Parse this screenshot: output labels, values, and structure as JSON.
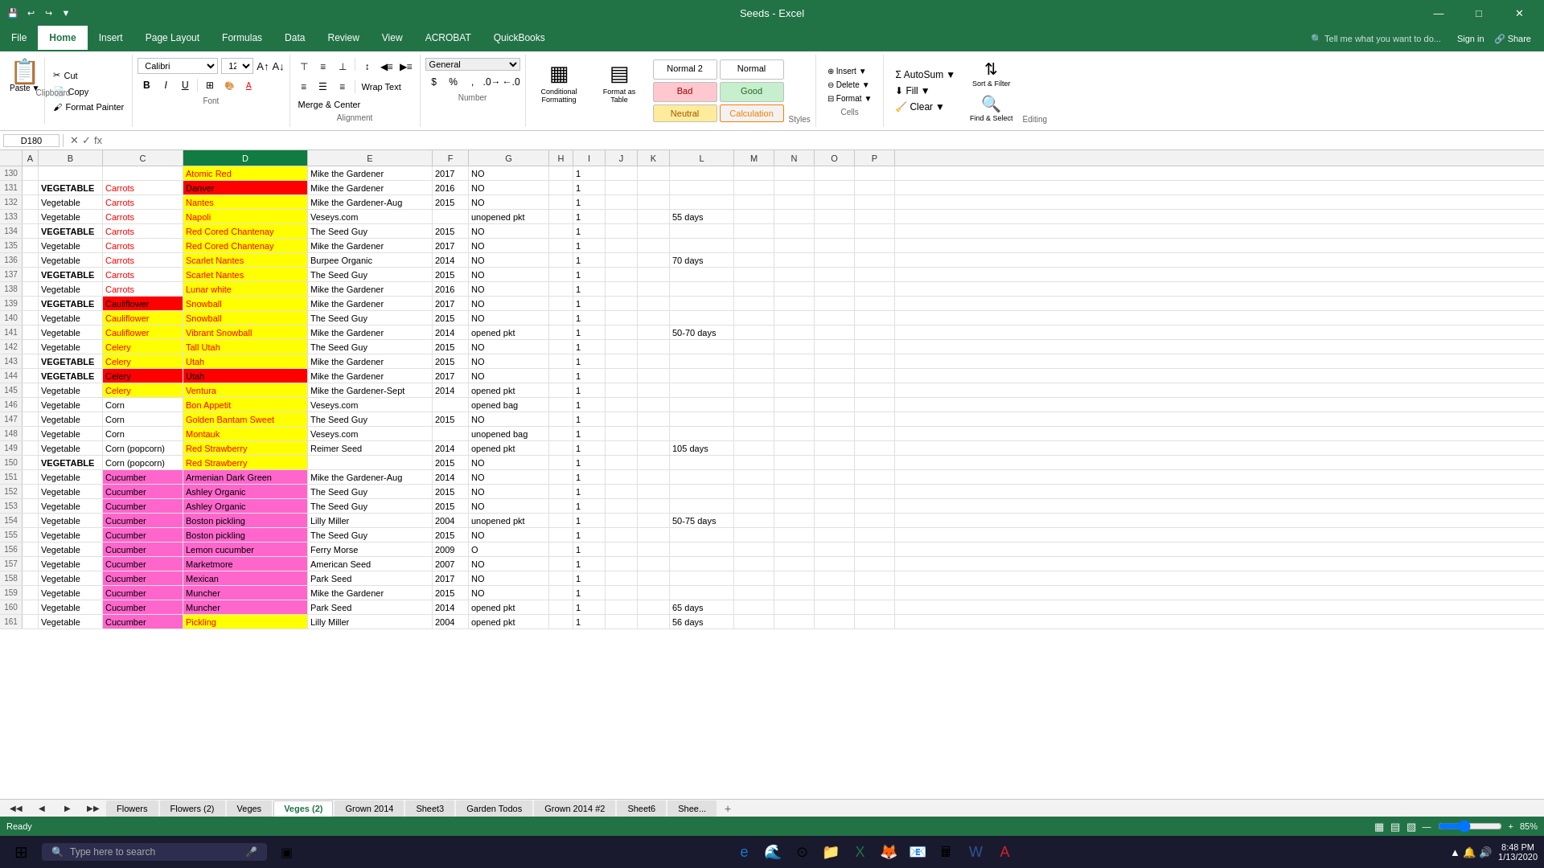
{
  "titlebar": {
    "title": "Seeds - Excel",
    "minimize": "—",
    "maximize": "□",
    "close": "✕"
  },
  "ribbon": {
    "tabs": [
      "File",
      "Home",
      "Insert",
      "Page Layout",
      "Formulas",
      "Data",
      "Review",
      "View",
      "ACROBAT",
      "QuickBooks"
    ],
    "active_tab": "Home",
    "search_placeholder": "Tell me what you want to do...",
    "groups": {
      "clipboard": {
        "label": "Clipboard",
        "paste": "Paste",
        "cut": "Cut",
        "copy": "Copy",
        "format_painter": "Format Painter"
      },
      "font": {
        "label": "Font",
        "name": "Calibri",
        "size": "12"
      },
      "alignment": {
        "label": "Alignment",
        "wrap_text": "Wrap Text",
        "merge_center": "Merge & Center"
      },
      "number": {
        "label": "Number",
        "format": "General"
      },
      "styles": {
        "label": "Styles",
        "normal2_label": "Normal 2",
        "normal_label": "Normal",
        "bad_label": "Bad",
        "good_label": "Good",
        "neutral_label": "Neutral",
        "calculation_label": "Calculation",
        "cond_format": "Conditional Formatting",
        "format_table": "Format as Table"
      },
      "cells": {
        "label": "Cells",
        "insert": "Insert",
        "delete": "Delete",
        "format": "Format"
      },
      "editing": {
        "label": "Editing",
        "autosum": "AutoSum",
        "fill": "Fill",
        "clear": "Clear",
        "sort_filter": "Sort & Filter",
        "find_select": "Find & Select"
      }
    }
  },
  "formula_bar": {
    "cell_ref": "D180",
    "formula": ""
  },
  "columns": [
    "",
    "A",
    "B",
    "C",
    "D",
    "E",
    "F",
    "G",
    "H",
    "I",
    "J",
    "K",
    "L",
    "M",
    "N",
    "O",
    "P"
  ],
  "rows": [
    {
      "num": "130",
      "a": "",
      "b": "",
      "c": "",
      "d": "Atomic Red",
      "e": "Mike the Gardener",
      "f": "2017",
      "g": "NO",
      "h": "",
      "i": "1",
      "j": "",
      "k": "",
      "l": "",
      "m": "",
      "n": "",
      "o": "",
      "p": "",
      "d_style": "bg-yellow text-red",
      "b_style": "text-uppercase font-bold",
      "c_style": "text-red"
    },
    {
      "num": "131",
      "a": "",
      "b": "VEGETABLE",
      "c": "Carrots",
      "d": "Danver",
      "e": "Mike the Gardener",
      "f": "2016",
      "g": "NO",
      "h": "",
      "i": "1",
      "j": "",
      "k": "",
      "l": "",
      "m": "",
      "n": "",
      "o": "",
      "p": "",
      "d_style": "bg-red text-black",
      "b_style": "text-uppercase font-bold",
      "c_style": "text-red"
    },
    {
      "num": "132",
      "a": "",
      "b": "Vegetable",
      "c": "Carrots",
      "d": "Nantes",
      "e": "Mike the Gardener-Aug",
      "f": "2015",
      "g": "NO",
      "h": "",
      "i": "1",
      "j": "",
      "k": "",
      "l": "",
      "m": "",
      "n": "",
      "o": "",
      "p": "",
      "d_style": "bg-yellow text-red",
      "c_style": "text-red"
    },
    {
      "num": "133",
      "a": "",
      "b": "Vegetable",
      "c": "Carrots",
      "d": "Napoli",
      "e": "Veseys.com",
      "f": "",
      "g": "unopened pkt",
      "h": "",
      "i": "1",
      "j": "",
      "k": "",
      "l": "55 days",
      "m": "",
      "n": "",
      "o": "",
      "p": "",
      "d_style": "bg-yellow text-red",
      "c_style": "text-red"
    },
    {
      "num": "134",
      "a": "",
      "b": "VEGETABLE",
      "c": "Carrots",
      "d": "Red Cored Chantenay",
      "e": "The Seed Guy",
      "f": "2015",
      "g": "NO",
      "h": "",
      "i": "1",
      "j": "",
      "k": "",
      "l": "",
      "m": "",
      "n": "",
      "o": "",
      "p": "",
      "d_style": "bg-yellow text-red",
      "b_style": "text-uppercase font-bold",
      "c_style": "text-red"
    },
    {
      "num": "135",
      "a": "",
      "b": "Vegetable",
      "c": "Carrots",
      "d": "Red Cored Chantenay",
      "e": "Mike the Gardener",
      "f": "2017",
      "g": "NO",
      "h": "",
      "i": "1",
      "j": "",
      "k": "",
      "l": "",
      "m": "",
      "n": "",
      "o": "",
      "p": "",
      "d_style": "bg-yellow text-red",
      "c_style": "text-red"
    },
    {
      "num": "136",
      "a": "",
      "b": "Vegetable",
      "c": "Carrots",
      "d": "Scarlet Nantes",
      "e": "Burpee Organic",
      "f": "2014",
      "g": "NO",
      "h": "",
      "i": "1",
      "j": "",
      "k": "",
      "l": "70 days",
      "m": "",
      "n": "",
      "o": "",
      "p": "",
      "d_style": "bg-yellow text-red",
      "c_style": "text-red"
    },
    {
      "num": "137",
      "a": "",
      "b": "VEGETABLE",
      "c": "Carrots",
      "d": "Scarlet Nantes",
      "e": "The Seed Guy",
      "f": "2015",
      "g": "NO",
      "h": "",
      "i": "1",
      "j": "",
      "k": "",
      "l": "",
      "m": "",
      "n": "",
      "o": "",
      "p": "",
      "d_style": "bg-yellow text-red",
      "b_style": "text-uppercase font-bold",
      "c_style": "text-red"
    },
    {
      "num": "138",
      "a": "",
      "b": "Vegetable",
      "c": "Carrots",
      "d": "Lunar white",
      "e": "Mike the Gardener",
      "f": "2016",
      "g": "NO",
      "h": "",
      "i": "1",
      "j": "",
      "k": "",
      "l": "",
      "m": "",
      "n": "",
      "o": "",
      "p": "",
      "d_style": "bg-yellow text-red",
      "c_style": "text-red"
    },
    {
      "num": "139",
      "a": "",
      "b": "VEGETABLE",
      "c": "Cauliflower",
      "d": "Snowball",
      "e": "Mike the Gardener",
      "f": "2017",
      "g": "NO",
      "h": "",
      "i": "1",
      "j": "",
      "k": "",
      "l": "",
      "m": "",
      "n": "",
      "o": "",
      "p": "",
      "d_style": "bg-yellow text-red",
      "b_style": "text-uppercase font-bold",
      "c_style": "bg-red text-black"
    },
    {
      "num": "140",
      "a": "",
      "b": "Vegetable",
      "c": "Cauliflower",
      "d": "Snowball",
      "e": "The Seed Guy",
      "f": "2015",
      "g": "NO",
      "h": "",
      "i": "1",
      "j": "",
      "k": "",
      "l": "",
      "m": "",
      "n": "",
      "o": "",
      "p": "",
      "d_style": "bg-yellow text-red",
      "c_style": "bg-yellow text-red"
    },
    {
      "num": "141",
      "a": "",
      "b": "Vegetable",
      "c": "Cauliflower",
      "d": "Vibrant Snowball",
      "e": "Mike the Gardener",
      "f": "2014",
      "g": "opened pkt",
      "h": "",
      "i": "1",
      "j": "",
      "k": "",
      "l": "50-70 days",
      "m": "",
      "n": "",
      "o": "",
      "p": "",
      "d_style": "bg-yellow text-red",
      "c_style": "bg-yellow text-red"
    },
    {
      "num": "142",
      "a": "",
      "b": "Vegetable",
      "c": "Celery",
      "d": "Tall Utah",
      "e": "The Seed Guy",
      "f": "2015",
      "g": "NO",
      "h": "",
      "i": "1",
      "j": "",
      "k": "",
      "l": "",
      "m": "",
      "n": "",
      "o": "",
      "p": "",
      "d_style": "bg-yellow text-red",
      "c_style": "bg-yellow text-red"
    },
    {
      "num": "143",
      "a": "",
      "b": "VEGETABLE",
      "c": "Celery",
      "d": "Utah",
      "e": "Mike the Gardener",
      "f": "2015",
      "g": "NO",
      "h": "",
      "i": "1",
      "j": "",
      "k": "",
      "l": "",
      "m": "",
      "n": "",
      "o": "",
      "p": "",
      "d_style": "bg-yellow text-red",
      "b_style": "text-uppercase font-bold",
      "c_style": "bg-yellow text-red"
    },
    {
      "num": "144",
      "a": "",
      "b": "VEGETABLE",
      "c": "Celery",
      "d": "Utah",
      "e": "Mike the Gardener",
      "f": "2017",
      "g": "NO",
      "h": "",
      "i": "1",
      "j": "",
      "k": "",
      "l": "",
      "m": "",
      "n": "",
      "o": "",
      "p": "",
      "d_style": "bg-red text-black",
      "b_style": "text-uppercase font-bold",
      "c_style": "bg-red text-black"
    },
    {
      "num": "145",
      "a": "",
      "b": "Vegetable",
      "c": "Celery",
      "d": "Ventura",
      "e": "Mike the Gardener-Sept",
      "f": "2014",
      "g": "opened pkt",
      "h": "",
      "i": "1",
      "j": "",
      "k": "",
      "l": "",
      "m": "",
      "n": "",
      "o": "",
      "p": "",
      "d_style": "bg-yellow text-red",
      "c_style": "bg-yellow text-red"
    },
    {
      "num": "146",
      "a": "",
      "b": "Vegetable",
      "c": "Corn",
      "d": "Bon Appetit",
      "e": "Veseys.com",
      "f": "",
      "g": "opened bag",
      "h": "",
      "i": "1",
      "j": "",
      "k": "",
      "l": "",
      "m": "",
      "n": "",
      "o": "",
      "p": "",
      "d_style": "bg-yellow text-red",
      "c_style": ""
    },
    {
      "num": "147",
      "a": "",
      "b": "Vegetable",
      "c": "Corn",
      "d": "Golden Bantam Sweet",
      "e": "The Seed Guy",
      "f": "2015",
      "g": "NO",
      "h": "",
      "i": "1",
      "j": "",
      "k": "",
      "l": "",
      "m": "",
      "n": "",
      "o": "",
      "p": "",
      "d_style": "bg-yellow text-red",
      "c_style": ""
    },
    {
      "num": "148",
      "a": "",
      "b": "Vegetable",
      "c": "Corn",
      "d": "Montauk",
      "e": "Veseys.com",
      "f": "",
      "g": "unopened bag",
      "h": "",
      "i": "1",
      "j": "",
      "k": "",
      "l": "",
      "m": "",
      "n": "",
      "o": "",
      "p": "",
      "d_style": "bg-yellow text-red",
      "c_style": ""
    },
    {
      "num": "149",
      "a": "",
      "b": "Vegetable",
      "c": "Corn (popcorn)",
      "d": "Red Strawberry",
      "e": "Reimer Seed",
      "f": "2014",
      "g": "opened pkt",
      "h": "",
      "i": "1",
      "j": "",
      "k": "",
      "l": "105 days",
      "m": "",
      "n": "",
      "o": "",
      "p": "",
      "d_style": "bg-yellow text-red",
      "c_style": ""
    },
    {
      "num": "150",
      "a": "",
      "b": "VEGETABLE",
      "c": "Corn (popcorn)",
      "d": "Red Strawberry",
      "e": "",
      "f": "2015",
      "g": "NO",
      "h": "",
      "i": "1",
      "j": "",
      "k": "",
      "l": "",
      "m": "",
      "n": "",
      "o": "",
      "p": "",
      "d_style": "bg-yellow text-red",
      "b_style": "text-uppercase font-bold",
      "c_style": ""
    },
    {
      "num": "151",
      "a": "",
      "b": "Vegetable",
      "c": "Cucumber",
      "d": "Armenian Dark Green",
      "e": "Mike the Gardener-Aug",
      "f": "2014",
      "g": "NO",
      "h": "",
      "i": "1",
      "j": "",
      "k": "",
      "l": "",
      "m": "",
      "n": "",
      "o": "",
      "p": "",
      "d_style": "bg-pink text-black",
      "c_style": "bg-pink text-black"
    },
    {
      "num": "152",
      "a": "",
      "b": "Vegetable",
      "c": "Cucumber",
      "d": "Ashley Organic",
      "e": "The Seed Guy",
      "f": "2015",
      "g": "NO",
      "h": "",
      "i": "1",
      "j": "",
      "k": "",
      "l": "",
      "m": "",
      "n": "",
      "o": "",
      "p": "",
      "d_style": "bg-pink text-black",
      "c_style": "bg-pink text-black"
    },
    {
      "num": "153",
      "a": "",
      "b": "Vegetable",
      "c": "Cucumber",
      "d": "Ashley Organic",
      "e": "The Seed Guy",
      "f": "2015",
      "g": "NO",
      "h": "",
      "i": "1",
      "j": "",
      "k": "",
      "l": "",
      "m": "",
      "n": "",
      "o": "",
      "p": "",
      "d_style": "bg-pink text-black",
      "c_style": "bg-pink text-black"
    },
    {
      "num": "154",
      "a": "",
      "b": "Vegetable",
      "c": "Cucumber",
      "d": "Boston pickling",
      "e": "Lilly Miller",
      "f": "2004",
      "g": "unopened pkt",
      "h": "",
      "i": "1",
      "j": "",
      "k": "",
      "l": "50-75 days",
      "m": "",
      "n": "",
      "o": "",
      "p": "",
      "d_style": "bg-pink text-black",
      "c_style": "bg-pink text-black"
    },
    {
      "num": "155",
      "a": "",
      "b": "Vegetable",
      "c": "Cucumber",
      "d": "Boston pickling",
      "e": "The Seed Guy",
      "f": "2015",
      "g": "NO",
      "h": "",
      "i": "1",
      "j": "",
      "k": "",
      "l": "",
      "m": "",
      "n": "",
      "o": "",
      "p": "",
      "d_style": "bg-pink text-black",
      "c_style": "bg-pink text-black"
    },
    {
      "num": "156",
      "a": "",
      "b": "Vegetable",
      "c": "Cucumber",
      "d": "Lemon cucumber",
      "e": "Ferry Morse",
      "f": "2009",
      "g": "O",
      "h": "",
      "i": "1",
      "j": "",
      "k": "",
      "l": "",
      "m": "",
      "n": "",
      "o": "",
      "p": "",
      "d_style": "bg-pink text-black",
      "c_style": "bg-pink text-black"
    },
    {
      "num": "157",
      "a": "",
      "b": "Vegetable",
      "c": "Cucumber",
      "d": "Marketmore",
      "e": "American Seed",
      "f": "2007",
      "g": "NO",
      "h": "",
      "i": "1",
      "j": "",
      "k": "",
      "l": "",
      "m": "",
      "n": "",
      "o": "",
      "p": "",
      "d_style": "bg-pink text-black",
      "c_style": "bg-pink text-black"
    },
    {
      "num": "158",
      "a": "",
      "b": "Vegetable",
      "c": "Cucumber",
      "d": "Mexican",
      "e": "Park Seed",
      "f": "2017",
      "g": "NO",
      "h": "",
      "i": "1",
      "j": "",
      "k": "",
      "l": "",
      "m": "",
      "n": "",
      "o": "",
      "p": "",
      "d_style": "bg-pink text-black",
      "c_style": "bg-pink text-black"
    },
    {
      "num": "159",
      "a": "",
      "b": "Vegetable",
      "c": "Cucumber",
      "d": "Muncher",
      "e": "Mike the Gardener",
      "f": "2015",
      "g": "NO",
      "h": "",
      "i": "1",
      "j": "",
      "k": "",
      "l": "",
      "m": "",
      "n": "",
      "o": "",
      "p": "",
      "d_style": "bg-pink text-black",
      "c_style": "bg-pink text-black"
    },
    {
      "num": "160",
      "a": "",
      "b": "Vegetable",
      "c": "Cucumber",
      "d": "Muncher",
      "e": "Park Seed",
      "f": "2014",
      "g": "opened pkt",
      "h": "",
      "i": "1",
      "j": "",
      "k": "",
      "l": "65 days",
      "m": "",
      "n": "",
      "o": "",
      "p": "",
      "d_style": "bg-pink text-black",
      "c_style": "bg-pink text-black"
    },
    {
      "num": "161",
      "a": "",
      "b": "Vegetable",
      "c": "Cucumber",
      "d": "Pickling",
      "e": "Lilly Miller",
      "f": "2004",
      "g": "opened pkt",
      "h": "",
      "i": "1",
      "j": "",
      "k": "",
      "l": "56 days",
      "m": "",
      "n": "",
      "o": "",
      "p": "",
      "d_style": "bg-yellow text-red",
      "c_style": "bg-pink text-black"
    }
  ],
  "sheet_tabs": [
    "Flowers",
    "Flowers (2)",
    "Veges",
    "Veges (2)",
    "Grown 2014",
    "Sheet3",
    "Garden Todos",
    "Grown 2014 #2",
    "Sheet6",
    "Shee..."
  ],
  "active_tab": "Veges (2)",
  "status_bar": {
    "left": "Ready",
    "zoom": "85%"
  },
  "taskbar": {
    "search_placeholder": "Type here to search",
    "time": "8:48 PM",
    "date": "1/13/2020"
  }
}
